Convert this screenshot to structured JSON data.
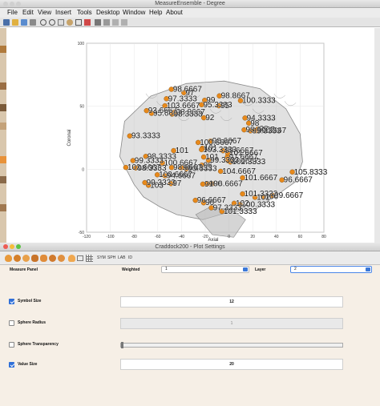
{
  "figure": {
    "title": "MeasureEnsemble - Degree",
    "menu": [
      "File",
      "Edit",
      "View",
      "Insert",
      "Tools",
      "Desktop",
      "Window",
      "Help",
      "About"
    ],
    "plot": {
      "xlabel": "Axial",
      "ylabel": "Coronal",
      "x_ticks": [
        "-120",
        "-100",
        "-80",
        "-60",
        "-40",
        "-20",
        "0",
        "20",
        "40",
        "60",
        "80"
      ],
      "y_ticks": [
        "100",
        "50",
        "0",
        "-50"
      ],
      "xlim": [
        -120,
        80
      ],
      "ylim": [
        -50,
        100
      ],
      "node_color": "#e8891a",
      "brain_color": "#c9c9c9",
      "node_labels": [
        "98.6667",
        "99.3333",
        "101",
        "97.6667",
        "98.8667",
        "100.3333",
        "96.6667",
        "101.3333",
        "99.6667",
        "98.3333",
        "100.6667",
        "101.6667",
        "99",
        "104.6667",
        "95.6667",
        "93.3333",
        "97.3333",
        "100",
        "102.3333",
        "98",
        "103",
        "96",
        "99.3333",
        "98.6667",
        "105.8333",
        "103.3333",
        "95.3333",
        "101",
        "97",
        "102",
        "98.3333",
        "99.6667",
        "101.3333",
        "96.3333",
        "100.6667",
        "94.3333",
        "98.6667",
        "102.6667",
        "97.6667",
        "99",
        "101.6667",
        "93.6667",
        "96.6667",
        "98",
        "100.3333",
        "103.6667",
        "95",
        "99.6667",
        "97.3333",
        "101",
        "98.3333",
        "94.6667",
        "100",
        "102",
        "96.6667",
        "99.3333",
        "92",
        "97",
        "95.3333",
        "98.6667",
        "100.6667",
        "93.3333",
        "96",
        "98.8667"
      ]
    }
  },
  "plot_settings": {
    "title": "Craddock200 - Plot Settings",
    "toolbar_labels": [
      "SYM",
      "SPH",
      "LAB",
      "ID"
    ],
    "measure_panel_label": "Measure Panel",
    "weighted_label": "Weighted",
    "weighted_value": "1",
    "layer_label": "Layer",
    "layer_value": "2",
    "symbol_size": {
      "label": "Symbol Size",
      "value": "12",
      "checked": true
    },
    "sphere_radius": {
      "label": "Sphere Radius",
      "value": "1",
      "checked": false
    },
    "sphere_transparency": {
      "label": "Sphere Transparency",
      "level": 0,
      "checked": false
    },
    "value_size": {
      "label": "Value Size",
      "value": "20",
      "checked": true
    }
  }
}
